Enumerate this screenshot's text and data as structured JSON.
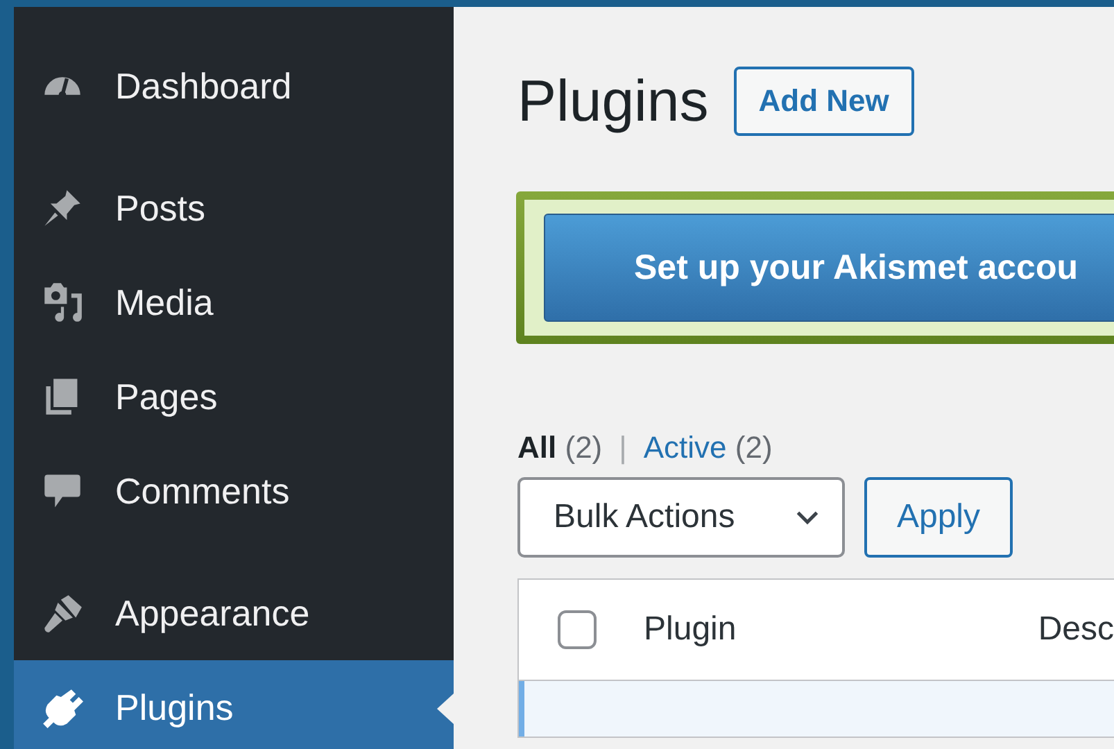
{
  "sidebar": {
    "groups": [
      {
        "items": [
          {
            "label": "Dashboard",
            "selected": false
          }
        ]
      },
      {
        "items": [
          {
            "label": "Posts",
            "selected": false
          },
          {
            "label": "Media",
            "selected": false
          },
          {
            "label": "Pages",
            "selected": false
          },
          {
            "label": "Comments",
            "selected": false
          }
        ]
      },
      {
        "items": [
          {
            "label": "Appearance",
            "selected": false
          },
          {
            "label": "Plugins",
            "selected": true
          }
        ]
      }
    ]
  },
  "page": {
    "title": "Plugins",
    "add_new_button": "Add New"
  },
  "notice": {
    "button": "Set up your Akismet accou"
  },
  "filters": [
    {
      "label": "All",
      "count": "(2)",
      "selected": true
    },
    {
      "label": "Active",
      "count": "(2)",
      "selected": false
    }
  ],
  "filter_separator": "|",
  "bulk_actions": {
    "value": "Bulk Actions",
    "apply_button": "Apply"
  },
  "table": {
    "header_checkbox": {
      "checked": false
    },
    "columns": [
      "Plugin",
      "Desc"
    ],
    "rows": [
      {
        "active": true
      }
    ]
  }
}
